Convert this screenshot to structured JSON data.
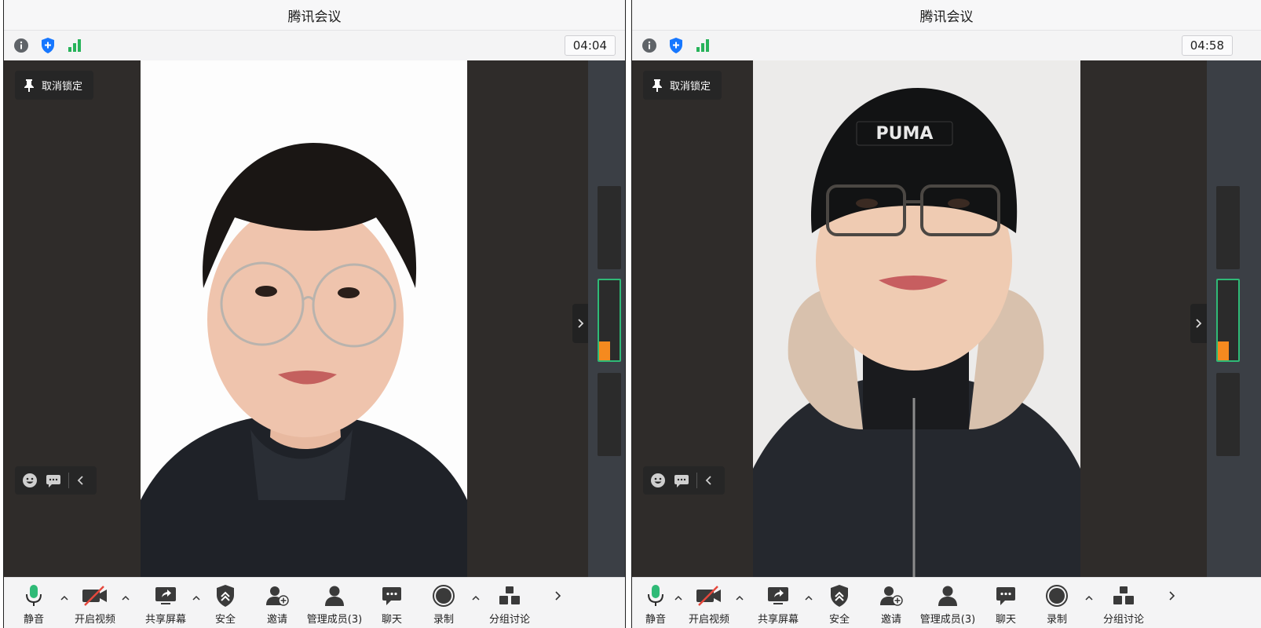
{
  "left_window": {
    "title": "腾讯会议",
    "timer": "04:04",
    "unpin_label": "取消锁定",
    "toolbar": {
      "mute": "静音",
      "video": "开启视频",
      "share": "共享屏幕",
      "security": "安全",
      "invite": "邀请",
      "members": "管理成员(3)",
      "chat": "聊天",
      "record": "录制",
      "breakout": "分组讨论"
    }
  },
  "right_window": {
    "title": "腾讯会议",
    "timer": "04:58",
    "unpin_label": "取消锁定",
    "hat_brand": "PUMA",
    "toolbar": {
      "mute": "静音",
      "video": "开启视频",
      "share": "共享屏幕",
      "security": "安全",
      "invite": "邀请",
      "members": "管理成员(3)",
      "chat": "聊天",
      "record": "录制",
      "breakout": "分组讨论"
    }
  },
  "colors": {
    "mic_green": "#2fba77",
    "shield_blue": "#1677ff",
    "signal_green": "#27b35a",
    "video_off_red": "#e5483d",
    "active_border": "#2fba77",
    "avatar_orange": "#f58a1f"
  }
}
